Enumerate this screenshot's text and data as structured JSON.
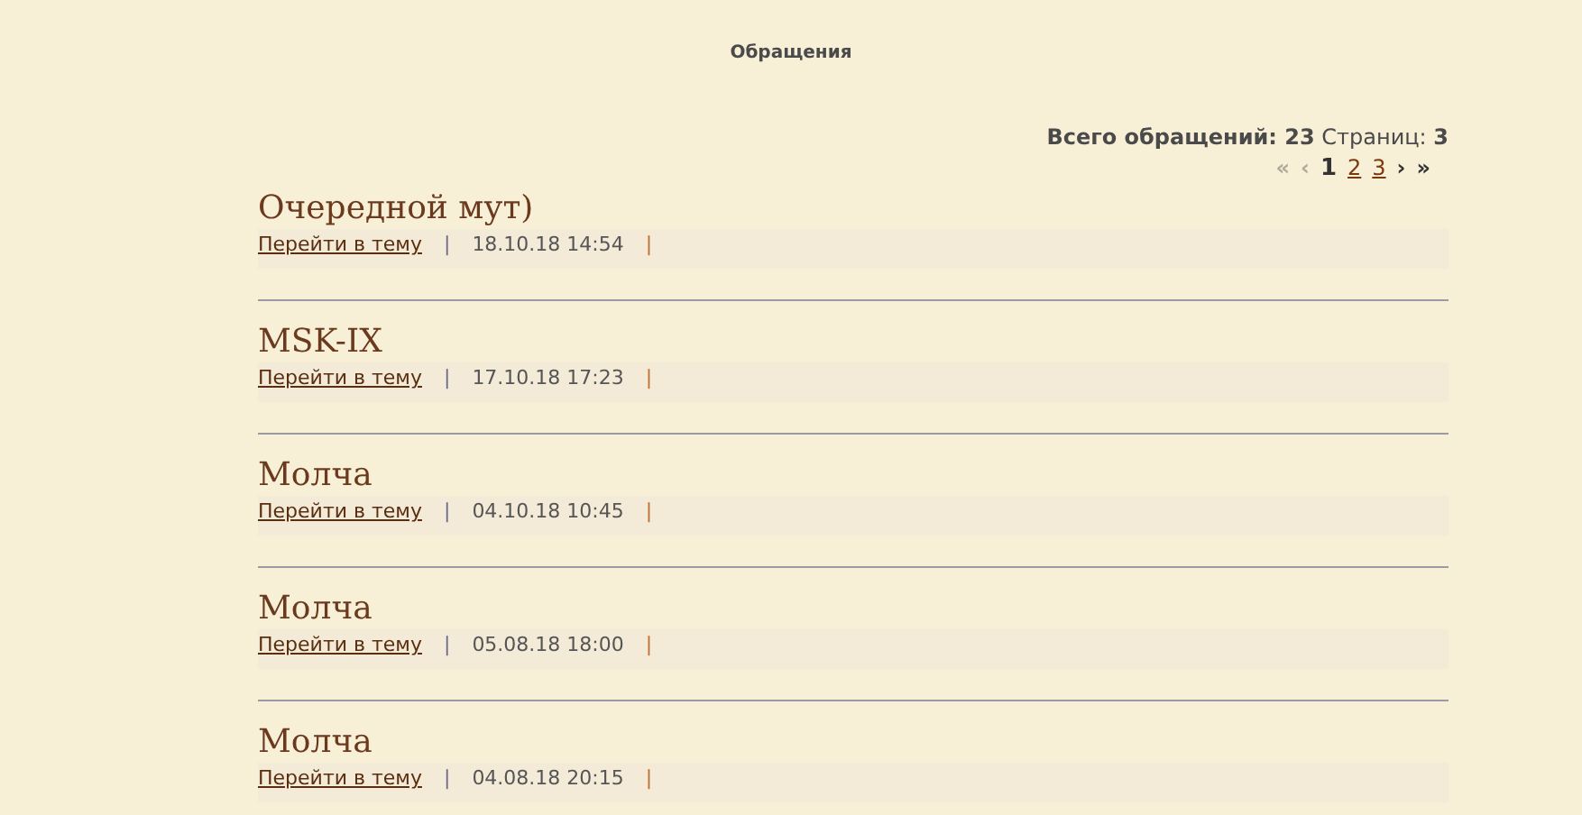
{
  "page_title": "Обращения",
  "summary": "**Всего обращений: 23** Страниц: **3**",
  "pagination": [
    {
      "label": "«",
      "kind": "arrow",
      "disabled": true,
      "selected": false
    },
    {
      "label": "‹",
      "kind": "arrow",
      "disabled": true,
      "selected": false
    },
    {
      "label": "1",
      "kind": "page",
      "disabled": false,
      "selected": true
    },
    {
      "label": "2",
      "kind": "page",
      "disabled": false,
      "selected": false
    },
    {
      "label": "3",
      "kind": "page",
      "disabled": false,
      "selected": false
    },
    {
      "label": "›",
      "kind": "arrow",
      "disabled": false,
      "selected": false
    },
    {
      "label": "»",
      "kind": "arrow",
      "disabled": false,
      "selected": false
    }
  ],
  "topics": [
    {
      "title": "Очередной мут)",
      "link": "Перейти в тему",
      "separator": "|",
      "date": "18.10.18 14:54",
      "end": "|"
    },
    {
      "title": "MSK-IX",
      "link": "Перейти в тему",
      "separator": "|",
      "date": "17.10.18 17:23",
      "end": "|"
    },
    {
      "title": "Молча",
      "link": "Перейти в тему",
      "separator": "|",
      "date": "04.10.18 10:45",
      "end": "|"
    },
    {
      "title": "Молча",
      "link": "Перейти в тему",
      "separator": "|",
      "date": "05.08.18 18:00",
      "end": "|"
    },
    {
      "title": "Молча",
      "link": "Перейти в тему",
      "separator": "|",
      "date": "04.08.18 20:15",
      "end": "|"
    }
  ]
}
